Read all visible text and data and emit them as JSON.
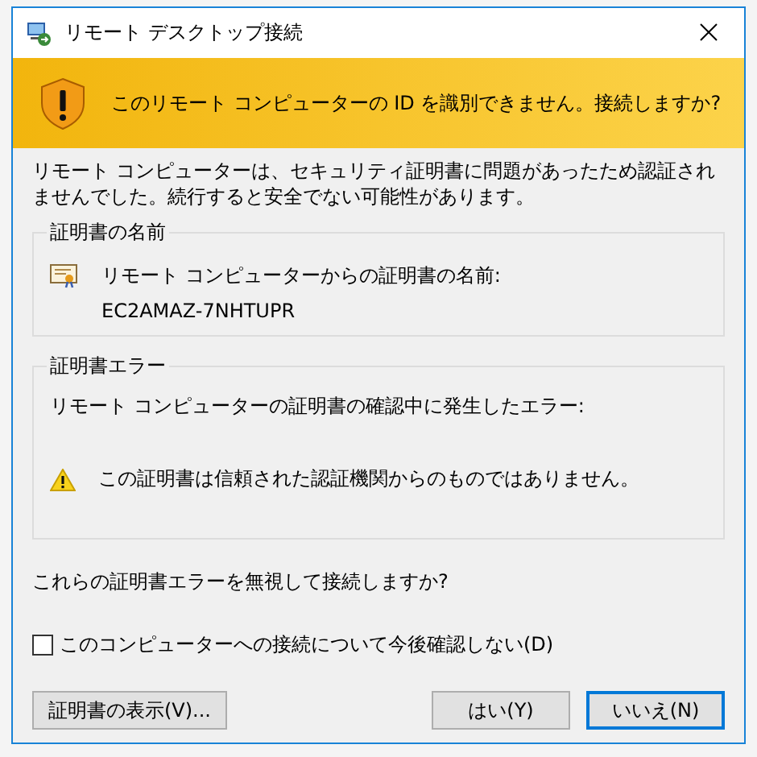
{
  "window": {
    "title": "リモート デスクトップ接続"
  },
  "banner": {
    "text": "このリモート コンピューターの ID を識別できません。接続しますか?"
  },
  "description": "リモート コンピューターは、セキュリティ証明書に問題があったため認証されませんでした。続行すると安全でない可能性があります。",
  "certificate_name": {
    "title": "証明書の名前",
    "label": "リモート コンピューターからの証明書の名前:",
    "value": "EC2AMAZ-7NHTUPR"
  },
  "certificate_errors": {
    "title": "証明書エラー",
    "intro": "リモート コンピューターの証明書の確認中に発生したエラー:",
    "messages": [
      "この証明書は信頼された認証機関からのものではありません。"
    ]
  },
  "question": "これらの証明書エラーを無視して接続しますか?",
  "checkbox": {
    "label": "このコンピューターへの接続について今後確認しない(D)",
    "checked": false
  },
  "buttons": [
    {
      "label": "証明書の表示(V)...",
      "default": false
    },
    {
      "label": "はい(Y)",
      "default": false
    },
    {
      "label": "いいえ(N)",
      "default": true
    }
  ]
}
